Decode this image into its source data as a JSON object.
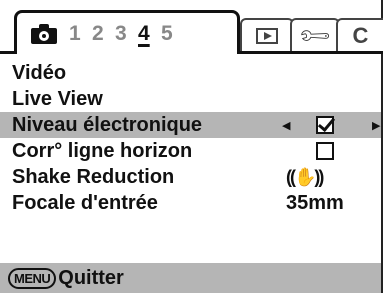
{
  "tabs": {
    "active_icon": "camera-icon",
    "pages": [
      "1",
      "2",
      "3",
      "4",
      "5"
    ],
    "current_page": "4",
    "other_tabs": [
      {
        "name": "playback",
        "icon": "playback-icon"
      },
      {
        "name": "setup",
        "icon": "wrench-icon"
      },
      {
        "name": "custom",
        "label": "C"
      }
    ]
  },
  "menu": {
    "items": [
      {
        "label": "Vidéo"
      },
      {
        "label": "Live View"
      },
      {
        "label": "Niveau électronique",
        "value_type": "checkbox",
        "checked": true,
        "selected": true
      },
      {
        "label": "Corr° ligne horizon",
        "value_type": "checkbox",
        "checked": false
      },
      {
        "label": "Shake Reduction",
        "value_type": "icon",
        "icon": "shake-reduction-icon",
        "glyph": "((✋))"
      },
      {
        "label": "Focale d'entrée",
        "value_type": "text",
        "value": "35mm"
      }
    ]
  },
  "footer": {
    "key_label": "MENU",
    "action_label": "Quitter"
  },
  "colors": {
    "highlight": "#b5b5b5",
    "text": "#111111",
    "inactive": "#888888"
  }
}
